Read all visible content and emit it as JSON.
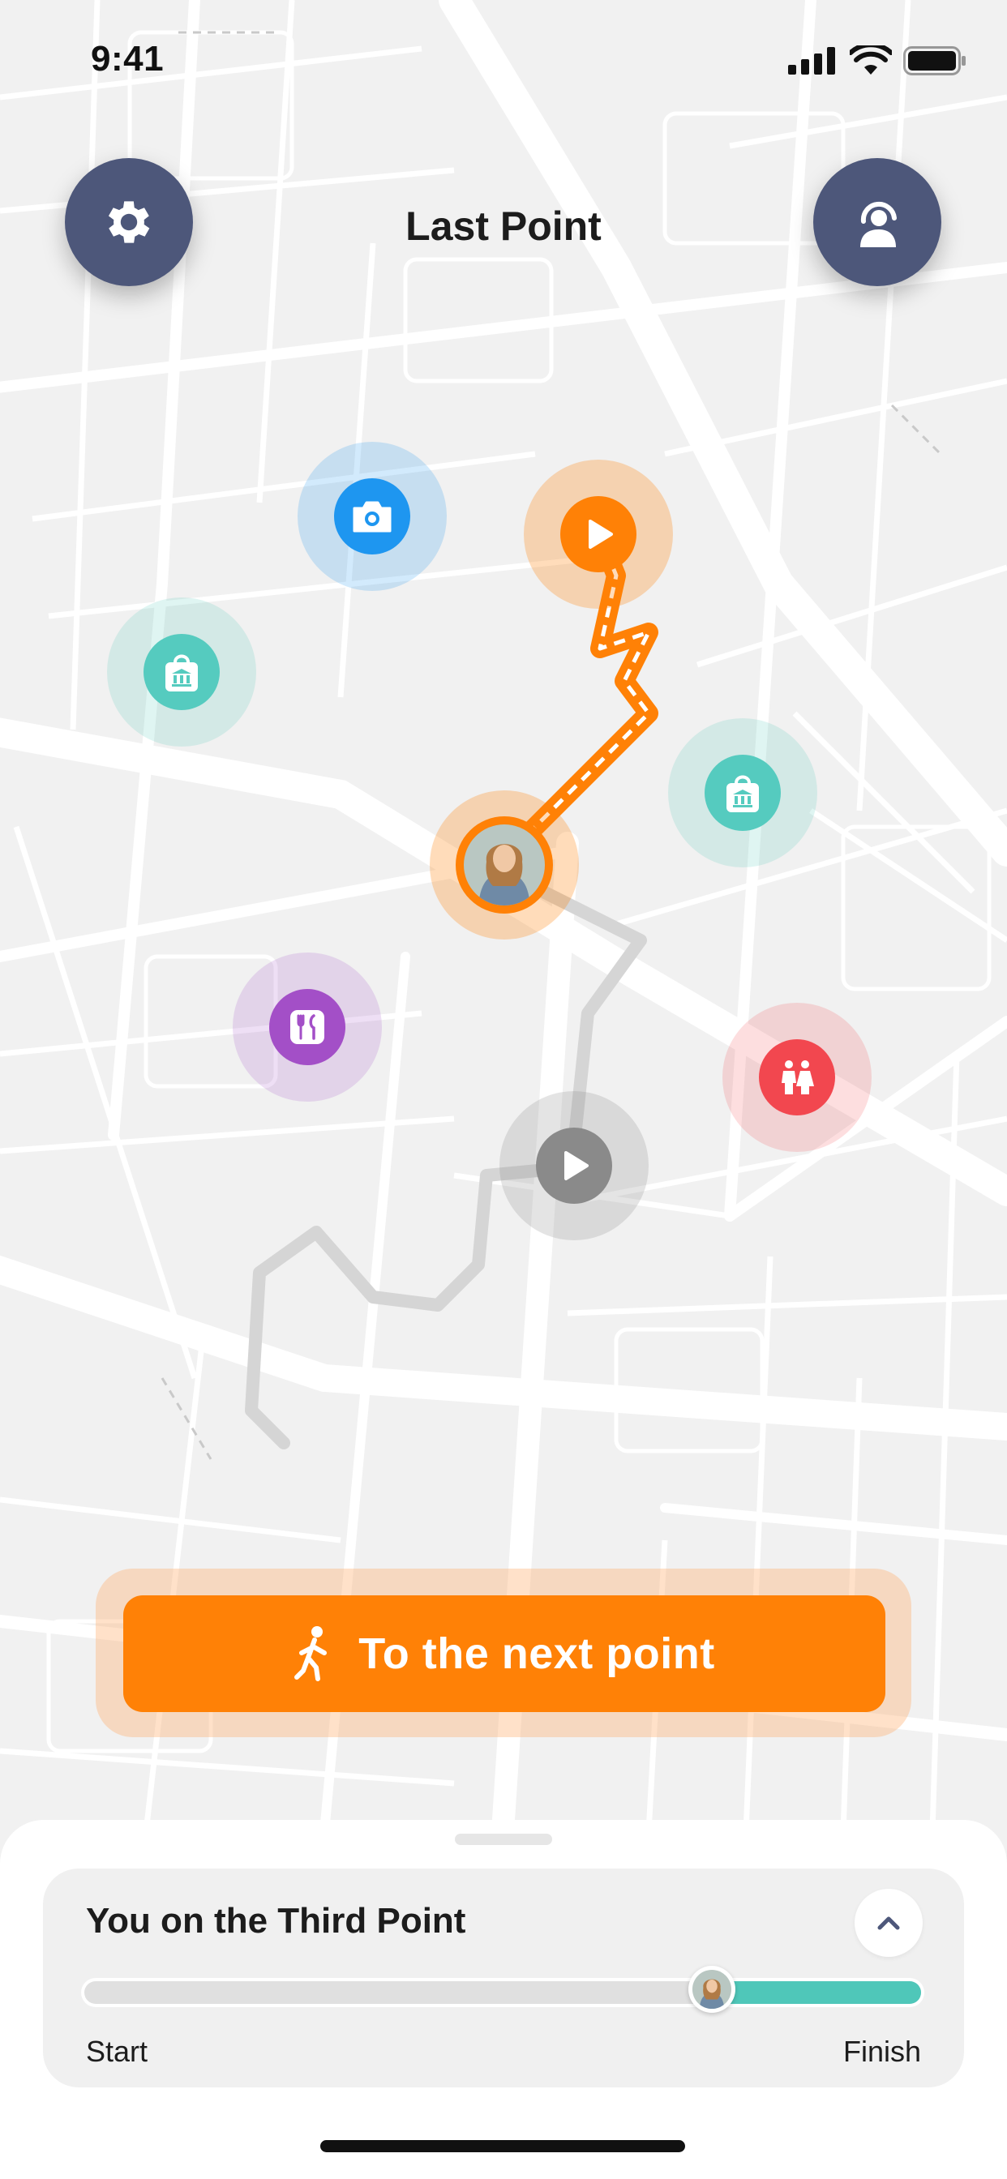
{
  "status_bar": {
    "time": "9:41"
  },
  "header": {
    "title": "Last Point"
  },
  "cta": {
    "label": "To the next point"
  },
  "progress": {
    "title": "You on the Third Point",
    "start_label": "Start",
    "finish_label": "Finish",
    "value": 0.75
  },
  "icons": {
    "settings": "gear-icon",
    "assistant": "headset-icon",
    "camera": "camera-icon",
    "museum": "museum-bag-icon",
    "play": "play-icon",
    "food": "fork-knife-icon",
    "restroom": "restroom-icon",
    "walk": "walking-person-icon"
  },
  "colors": {
    "accent": "#ff8106",
    "navy": "#4d577a",
    "teal": "#4fc7b9",
    "camera_blue": "#1e96f0",
    "food_purple": "#a34fc7",
    "restroom_red": "#f2474f",
    "grey_marker": "#8a8a8a"
  }
}
